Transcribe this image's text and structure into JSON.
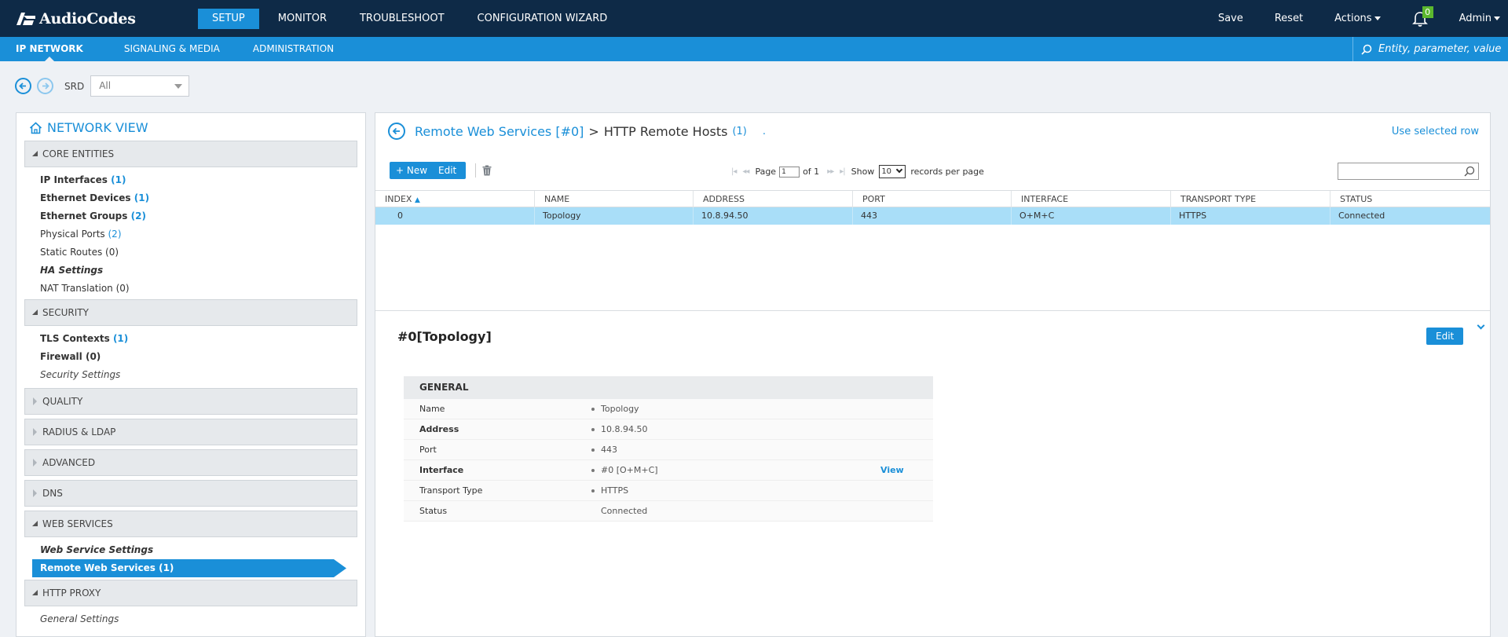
{
  "app": {
    "brand": "AudioCodes"
  },
  "topnav": {
    "tabs": [
      {
        "label": "SETUP"
      },
      {
        "label": "MONITOR"
      },
      {
        "label": "TROUBLESHOOT"
      },
      {
        "label": "CONFIGURATION WIZARD"
      }
    ],
    "save": "Save",
    "reset": "Reset",
    "actions": "Actions",
    "notifications": "0",
    "user": "Admin"
  },
  "subnav": {
    "tabs": [
      {
        "label": "IP NETWORK"
      },
      {
        "label": "SIGNALING & MEDIA"
      },
      {
        "label": "ADMINISTRATION"
      }
    ],
    "search_placeholder": "Entity, parameter, value"
  },
  "srd": {
    "label": "SRD",
    "value": "All"
  },
  "network_view": {
    "title": "NETWORK VIEW",
    "sections": [
      {
        "label": "CORE ENTITIES"
      },
      {
        "label": "SECURITY"
      },
      {
        "label": "QUALITY"
      },
      {
        "label": "RADIUS & LDAP"
      },
      {
        "label": "ADVANCED"
      },
      {
        "label": "DNS"
      },
      {
        "label": "WEB SERVICES"
      },
      {
        "label": "HTTP PROXY"
      }
    ],
    "core_items": [
      {
        "label": "IP Interfaces",
        "count": "(1)"
      },
      {
        "label": "Ethernet Devices",
        "count": "(1)"
      },
      {
        "label": "Ethernet Groups",
        "count": "(2)"
      },
      {
        "label": "Physical Ports",
        "count": "(2)"
      },
      {
        "label": "Static Routes (0)"
      },
      {
        "label": "HA Settings"
      },
      {
        "label": "NAT Translation (0)"
      }
    ],
    "security_items": [
      {
        "label": "TLS Contexts",
        "count": "(1)"
      },
      {
        "label": "Firewall (0)"
      },
      {
        "label": "Security Settings"
      }
    ],
    "web_items": [
      {
        "label": "Web Service Settings"
      },
      {
        "label": "Remote Web Services (1)"
      }
    ],
    "proxy_items": [
      {
        "label": "General Settings"
      }
    ]
  },
  "main": {
    "breadcrumb_parent": "Remote Web Services [#0]",
    "breadcrumb_sep": ">",
    "breadcrumb_current": "HTTP Remote Hosts",
    "breadcrumb_count": "(1)",
    "breadcrumb_dot": ".",
    "use_selected_row": "Use selected row",
    "new_button": "+ New",
    "edit_button": "Edit",
    "pager": {
      "page_label": "Page",
      "page_value": "1",
      "of_label": "of 1",
      "show_label": "Show",
      "per_page_value": "10",
      "records_label": "records per page"
    },
    "columns": [
      "INDEX",
      "NAME",
      "ADDRESS",
      "PORT",
      "INTERFACE",
      "TRANSPORT TYPE",
      "STATUS"
    ],
    "rows": [
      [
        "0",
        "Topology",
        "10.8.94.50",
        "443",
        "O+M+C",
        "HTTPS",
        "Connected"
      ]
    ],
    "record_title": "#0[Topology]",
    "record_edit": "Edit",
    "general": {
      "title": "GENERAL",
      "fields": [
        {
          "key": "Name",
          "value": "Topology"
        },
        {
          "key": "Address",
          "value": "10.8.94.50"
        },
        {
          "key": "Port",
          "value": "443"
        },
        {
          "key": "Interface",
          "value": "#0 [O+M+C]",
          "action": "View"
        },
        {
          "key": "Transport Type",
          "value": "HTTPS"
        },
        {
          "key": "Status",
          "value": "Connected"
        }
      ]
    }
  },
  "colors": {
    "navy": "#0e2a47",
    "accent": "#1a8fd8",
    "selected_row": "#a9def8",
    "badge": "#5cb82e"
  }
}
